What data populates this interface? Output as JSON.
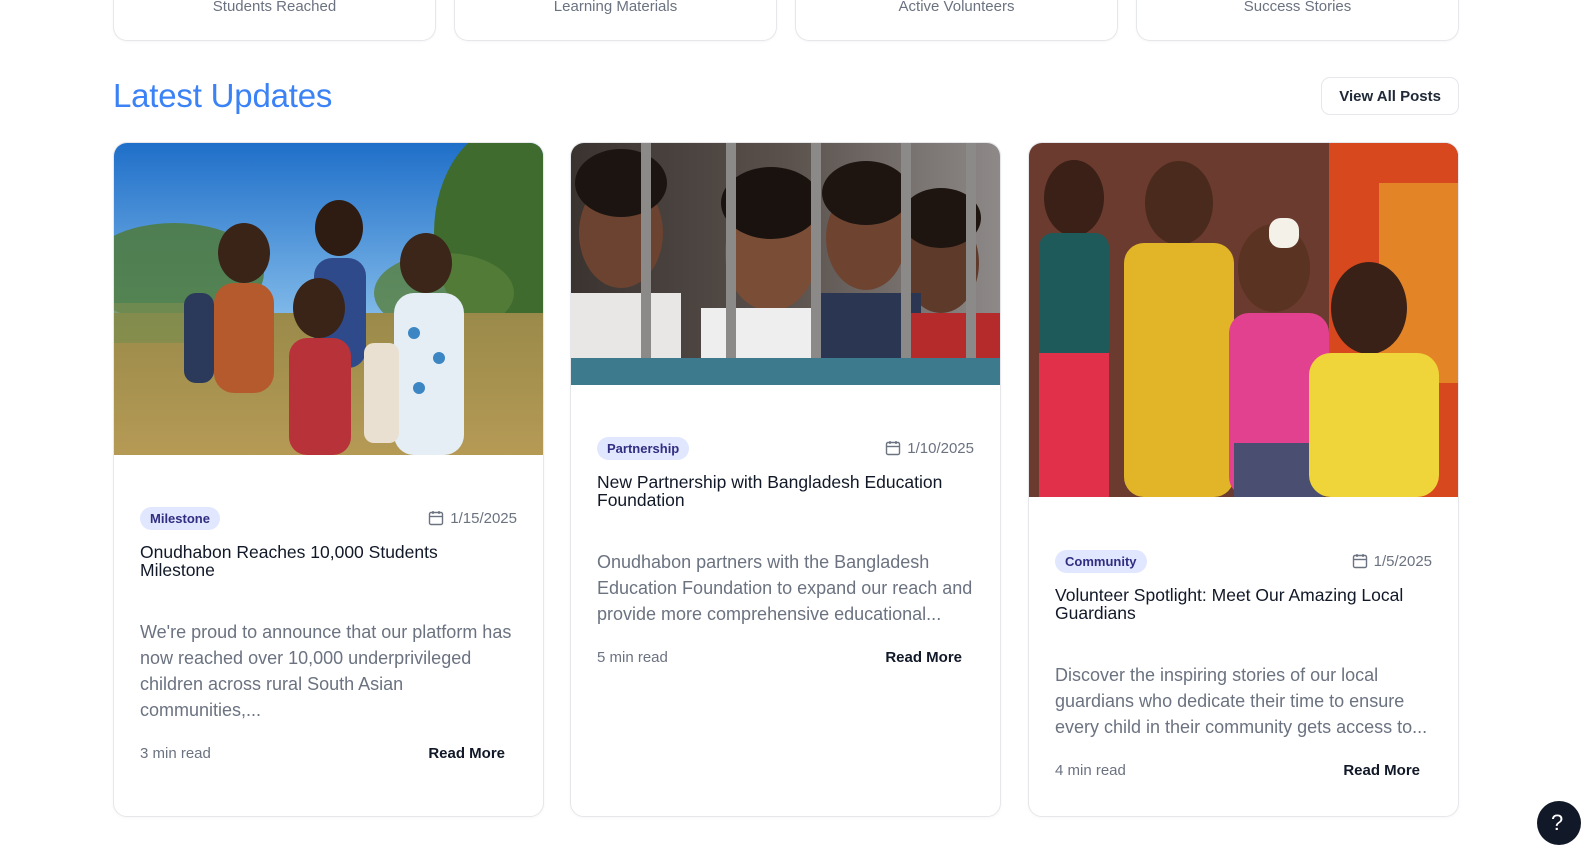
{
  "stats": [
    {
      "label": "Students Reached"
    },
    {
      "label": "Learning Materials"
    },
    {
      "label": "Active Volunteers"
    },
    {
      "label": "Success Stories"
    }
  ],
  "section": {
    "title": "Latest Updates",
    "view_all_label": "View All Posts"
  },
  "posts": [
    {
      "category": "Milestone",
      "date": "1/15/2025",
      "title": "Onudhabon Reaches 10,000 Students Milestone",
      "excerpt": "We're proud to announce that our platform has now reached over 10,000 underprivileged children across rural South Asian communities,...",
      "read_time": "3 min read",
      "read_more": "Read More",
      "image_icon": "children-photo"
    },
    {
      "category": "Partnership",
      "date": "1/10/2025",
      "title": "New Partnership with Bangladesh Education Foundation",
      "excerpt": "Onudhabon partners with the Bangladesh Education Foundation to expand our reach and provide more comprehensive educational...",
      "read_time": "5 min read",
      "read_more": "Read More",
      "image_icon": "children-photo"
    },
    {
      "category": "Community",
      "date": "1/5/2025",
      "title": "Volunteer Spotlight: Meet Our Amazing Local Guardians",
      "excerpt": "Discover the inspiring stories of our local guardians who dedicate their time to ensure every child in their community gets access to...",
      "read_time": "4 min read",
      "read_more": "Read More",
      "image_icon": "children-photo"
    }
  ],
  "help": {
    "label": "?"
  },
  "colors": {
    "accent": "#3b82f6",
    "badge_bg": "#e0e7ff",
    "badge_text": "#312e81"
  }
}
